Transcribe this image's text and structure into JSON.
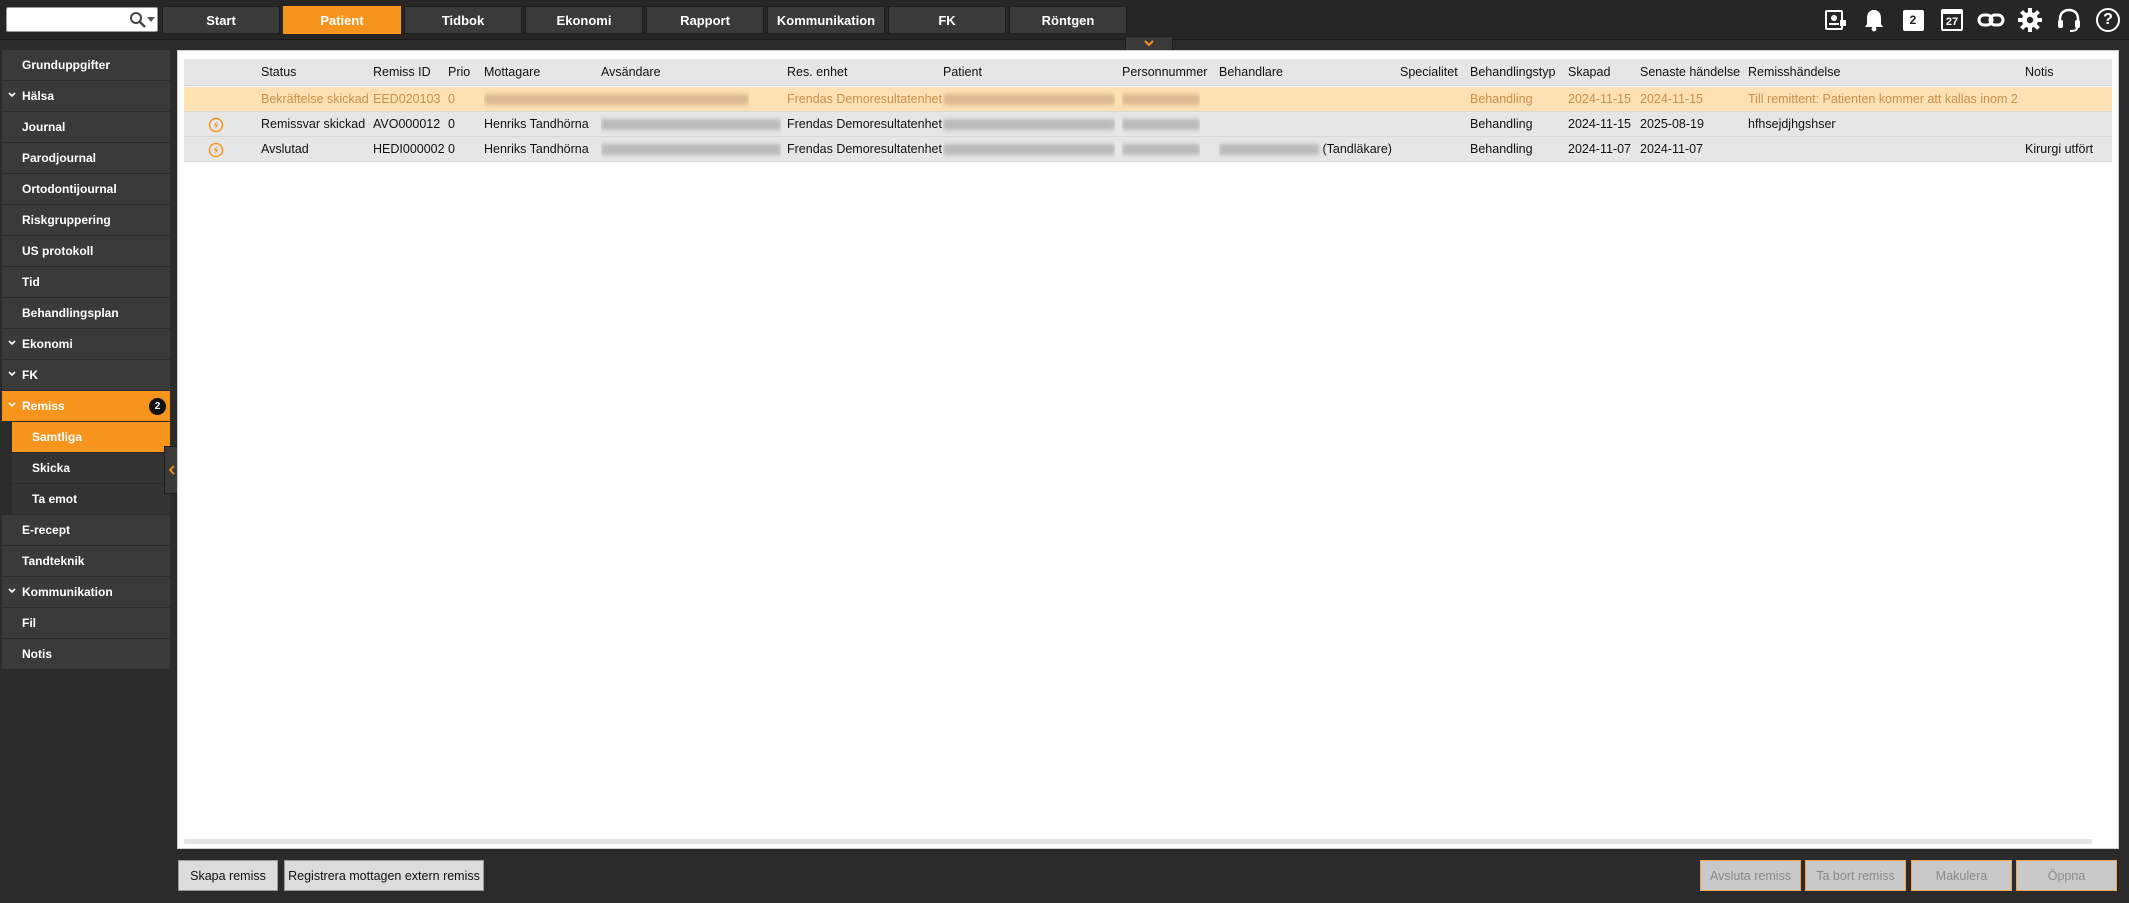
{
  "search": {
    "placeholder": ""
  },
  "tabs": [
    {
      "label": "Start",
      "active": false
    },
    {
      "label": "Patient",
      "active": true
    },
    {
      "label": "Tidbok",
      "active": false
    },
    {
      "label": "Ekonomi",
      "active": false
    },
    {
      "label": "Rapport",
      "active": false
    },
    {
      "label": "Kommunikation",
      "active": false
    },
    {
      "label": "FK",
      "active": false
    },
    {
      "label": "Röntgen",
      "active": false
    }
  ],
  "top_icons": {
    "calendar_day": "27",
    "counter_value": "2",
    "help": "?"
  },
  "sidebar": {
    "items": [
      {
        "label": "Grunduppgifter"
      },
      {
        "label": "Hälsa"
      },
      {
        "label": "Journal"
      },
      {
        "label": "Parodjournal"
      },
      {
        "label": "Ortodontijournal"
      },
      {
        "label": "Riskgruppering"
      },
      {
        "label": "US protokoll"
      },
      {
        "label": "Tid"
      },
      {
        "label": "Behandlingsplan"
      },
      {
        "label": "Ekonomi"
      },
      {
        "label": "FK"
      },
      {
        "label": "Remiss",
        "badge": "2"
      },
      {
        "label": "E-recept"
      },
      {
        "label": "Tandteknik"
      },
      {
        "label": "Kommunikation"
      },
      {
        "label": "Fil"
      },
      {
        "label": "Notis"
      }
    ],
    "remiss_sub": [
      {
        "label": "Samtliga"
      },
      {
        "label": "Skicka"
      },
      {
        "label": "Ta emot"
      }
    ]
  },
  "table": {
    "columns": {
      "status": "Status",
      "remiss_id": "Remiss ID",
      "prio": "Prio",
      "mottagare": "Mottagare",
      "avsandare": "Avsändare",
      "res_enhet": "Res. enhet",
      "patient": "Patient",
      "personnummer": "Personnummer",
      "behandlare": "Behandlare",
      "specialitet": "Specialitet",
      "behandlingstyp": "Behandlingstyp",
      "skapad": "Skapad",
      "senaste": "Senaste händelse",
      "remisshandelse": "Remisshändelse",
      "notis": "Notis"
    },
    "rows": [
      {
        "status": "Bekräftelse skickad",
        "remiss_id": "EED020103",
        "prio": "0",
        "mottagare": "",
        "avsandare": "",
        "res_enhet": "Frendas Demoresultatenhet",
        "behandlare": "",
        "behandlare_suffix": "",
        "specialitet": "",
        "behandlingstyp": "Behandling",
        "skapad": "2024-11-15",
        "senaste": "2024-11-15",
        "remisshandelse": "Till remittent: Patienten kommer att kallas inom 2...",
        "notis": ""
      },
      {
        "status": "Remissvar skickad",
        "remiss_id": "AVO000012",
        "prio": "0",
        "mottagare": "Henriks Tandhörna",
        "avsandare": "",
        "res_enhet": "Frendas Demoresultatenhet",
        "behandlare": "",
        "behandlare_suffix": "",
        "specialitet": "",
        "behandlingstyp": "Behandling",
        "skapad": "2024-11-15",
        "senaste": "2025-08-19",
        "remisshandelse": "hfhsejdjhgshser",
        "notis": ""
      },
      {
        "status": "Avslutad",
        "remiss_id": "HEDI000002",
        "prio": "0",
        "mottagare": "Henriks Tandhörna",
        "avsandare": "",
        "res_enhet": "Frendas Demoresultatenhet",
        "behandlare": "",
        "behandlare_suffix": "(Tandläkare)",
        "specialitet": "",
        "behandlingstyp": "Behandling",
        "skapad": "2024-11-07",
        "senaste": "2024-11-07",
        "remisshandelse": "",
        "notis": "Kirurgi utfört"
      }
    ]
  },
  "buttons": {
    "skapa": "Skapa remiss",
    "registrera": "Registrera mottagen extern remiss",
    "avsluta": "Avsluta remiss",
    "ta_bort": "Ta bort remiss",
    "makulera": "Makulera",
    "oppna": "Öppna"
  },
  "colors": {
    "accent": "#f7941d",
    "highlight_row": "#fde1b3",
    "background": "#2b2b2b"
  }
}
